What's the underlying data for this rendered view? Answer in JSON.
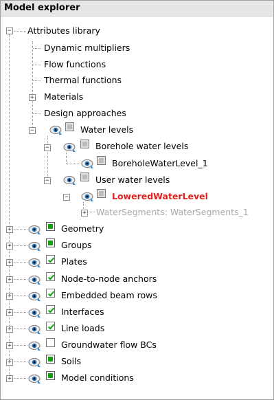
{
  "panel": {
    "title": "Model explorer"
  },
  "tree": {
    "attributes_library": "Attributes library",
    "dynamic_multipliers": "Dynamic multipliers",
    "flow_functions": "Flow functions",
    "thermal_functions": "Thermal functions",
    "materials": "Materials",
    "design_approaches": "Design approaches",
    "water_levels": "Water levels",
    "borehole_water_levels": "Borehole water levels",
    "borehole_water_level_1": "BoreholeWaterLevel_1",
    "user_water_levels": "User water levels",
    "lowered_water_level": "LoweredWaterLevel",
    "water_segments": "WaterSegments: WaterSegments_1",
    "geometry": "Geometry",
    "groups": "Groups",
    "plates": "Plates",
    "node_to_node_anchors": "Node-to-node anchors",
    "embedded_beam_rows": "Embedded beam rows",
    "interfaces": "Interfaces",
    "line_loads": "Line loads",
    "groundwater_flow_bcs": "Groundwater flow BCs",
    "soils": "Soils",
    "model_conditions": "Model conditions"
  },
  "colors": {
    "active_item": "#e0201c",
    "visibility_green": "#10a010",
    "disabled_text": "#a8a8a8"
  },
  "icons": {
    "expand_collapse": "plus-minus-box",
    "visibility": "eye-icon",
    "state": "checkbox"
  }
}
